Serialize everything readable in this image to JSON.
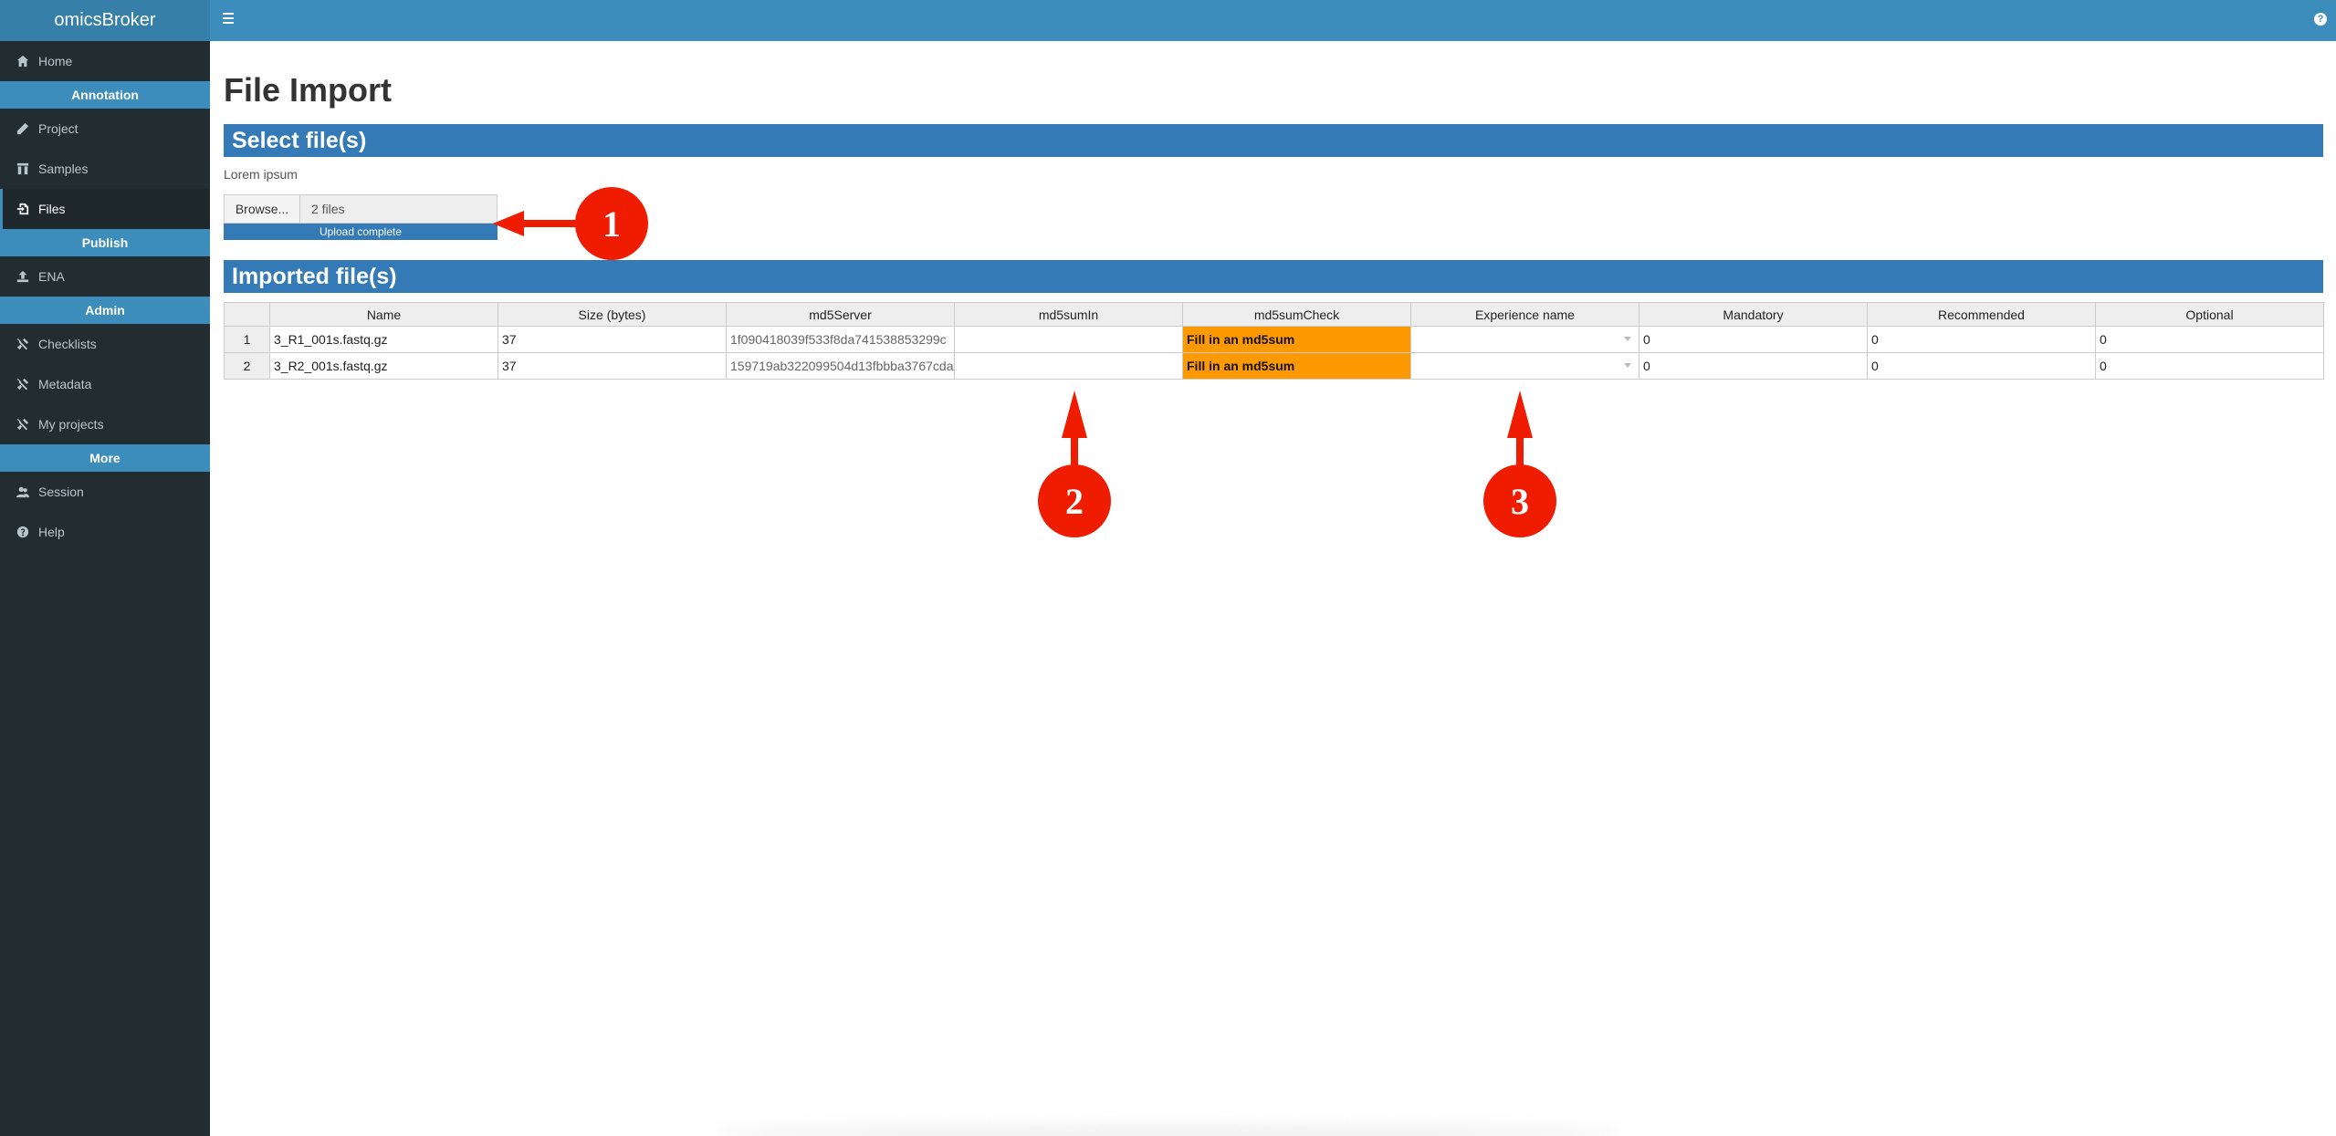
{
  "sidebar": {
    "logo": "omicsBroker",
    "home": "Home",
    "sections": [
      {
        "header": "Annotation",
        "items": [
          "Project",
          "Samples",
          "Files"
        ]
      },
      {
        "header": "Publish",
        "items": [
          "ENA"
        ]
      },
      {
        "header": "Admin",
        "items": [
          "Checklists",
          "Metadata",
          "My projects"
        ]
      },
      {
        "header": "More",
        "items": [
          "Session",
          "Help"
        ]
      }
    ],
    "active_item": "Files"
  },
  "topbar": {
    "help_icon": "question-circle-icon",
    "toggle_icon": "hamburger-icon"
  },
  "page": {
    "title": "File Import",
    "select_section": "Select file(s)",
    "lorem": "Lorem ipsum",
    "browse_label": "Browse...",
    "file_count_text": "2 files",
    "upload_status": "Upload complete",
    "upload_progress": 1.0,
    "imported_section": "Imported file(s)"
  },
  "table": {
    "columns": [
      "Name",
      "Size (bytes)",
      "md5Server",
      "md5sumIn",
      "md5sumCheck",
      "Experience name",
      "Mandatory",
      "Recommended",
      "Optional"
    ],
    "rows": [
      {
        "num": "1",
        "name": "3_R1_001s.fastq.gz",
        "size": "37",
        "md5server": "1f090418039f533f8da741538853299c",
        "md5in": "",
        "md5check": "Fill in an md5sum",
        "experience": "",
        "mandatory": "0",
        "recommended": "0",
        "optional": "0"
      },
      {
        "num": "2",
        "name": "3_R2_001s.fastq.gz",
        "size": "37",
        "md5server": "159719ab322099504d13fbbba3767cda",
        "md5in": "",
        "md5check": "Fill in an md5sum",
        "experience": "",
        "mandatory": "0",
        "recommended": "0",
        "optional": "0"
      }
    ]
  },
  "annotations": {
    "one": "1",
    "two": "2",
    "three": "3",
    "color": "#ef1c00"
  },
  "colors": {
    "brand": "#3c8dbc",
    "sidebar": "#222d32",
    "section": "#337ab7",
    "warning": "#ff9900"
  }
}
